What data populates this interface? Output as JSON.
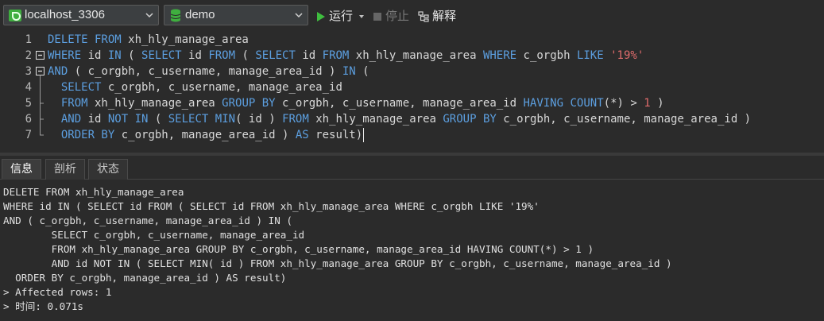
{
  "toolbar": {
    "connection": "localhost_3306",
    "database": "demo",
    "run_label": "运行",
    "stop_label": "停止",
    "explain_label": "解释",
    "colors": {
      "run_green": "#3fbe3f",
      "db_green": "#3fae3f"
    }
  },
  "editor": {
    "lines": [
      {
        "num": "1",
        "fold": "none",
        "tokens": [
          {
            "t": "DELETE FROM",
            "c": "kw"
          },
          {
            "t": " xh_hly_manage_area",
            "c": ""
          }
        ]
      },
      {
        "num": "2",
        "fold": "open",
        "tokens": [
          {
            "t": "WHERE",
            "c": "kw"
          },
          {
            "t": " id ",
            "c": ""
          },
          {
            "t": "IN",
            "c": "kw"
          },
          {
            "t": " ( ",
            "c": ""
          },
          {
            "t": "SELECT",
            "c": "kw"
          },
          {
            "t": " id ",
            "c": ""
          },
          {
            "t": "FROM",
            "c": "kw"
          },
          {
            "t": " ( ",
            "c": ""
          },
          {
            "t": "SELECT",
            "c": "kw"
          },
          {
            "t": " id ",
            "c": ""
          },
          {
            "t": "FROM",
            "c": "kw"
          },
          {
            "t": " xh_hly_manage_area ",
            "c": ""
          },
          {
            "t": "WHERE",
            "c": "kw"
          },
          {
            "t": " c_orgbh ",
            "c": ""
          },
          {
            "t": "LIKE",
            "c": "kw"
          },
          {
            "t": " ",
            "c": ""
          },
          {
            "t": "'19%'",
            "c": "str"
          }
        ]
      },
      {
        "num": "3",
        "fold": "open",
        "tokens": [
          {
            "t": "AND",
            "c": "kw"
          },
          {
            "t": " ( c_orgbh, c_username, manage_area_id ) ",
            "c": ""
          },
          {
            "t": "IN",
            "c": "kw"
          },
          {
            "t": " (",
            "c": ""
          }
        ]
      },
      {
        "num": "4",
        "fold": "line",
        "tokens": [
          {
            "t": "  ",
            "c": ""
          },
          {
            "t": "SELECT",
            "c": "kw"
          },
          {
            "t": " c_orgbh, c_username, manage_area_id",
            "c": ""
          }
        ]
      },
      {
        "num": "5",
        "fold": "dash",
        "tokens": [
          {
            "t": "  ",
            "c": ""
          },
          {
            "t": "FROM",
            "c": "kw"
          },
          {
            "t": " xh_hly_manage_area ",
            "c": ""
          },
          {
            "t": "GROUP BY",
            "c": "kw"
          },
          {
            "t": " c_orgbh, c_username, manage_area_id ",
            "c": ""
          },
          {
            "t": "HAVING",
            "c": "kw"
          },
          {
            "t": " ",
            "c": ""
          },
          {
            "t": "COUNT",
            "c": "kw"
          },
          {
            "t": "(*) > ",
            "c": ""
          },
          {
            "t": "1",
            "c": "num"
          },
          {
            "t": " )",
            "c": ""
          }
        ]
      },
      {
        "num": "6",
        "fold": "dash",
        "tokens": [
          {
            "t": "  ",
            "c": ""
          },
          {
            "t": "AND",
            "c": "kw"
          },
          {
            "t": " id ",
            "c": ""
          },
          {
            "t": "NOT IN",
            "c": "kw"
          },
          {
            "t": " ( ",
            "c": ""
          },
          {
            "t": "SELECT",
            "c": "kw"
          },
          {
            "t": " ",
            "c": ""
          },
          {
            "t": "MIN",
            "c": "kw"
          },
          {
            "t": "( id ) ",
            "c": ""
          },
          {
            "t": "FROM",
            "c": "kw"
          },
          {
            "t": " xh_hly_manage_area ",
            "c": ""
          },
          {
            "t": "GROUP BY",
            "c": "kw"
          },
          {
            "t": " c_orgbh, c_username, manage_area_id )",
            "c": ""
          }
        ]
      },
      {
        "num": "7",
        "fold": "end",
        "tokens": [
          {
            "t": "  ",
            "c": ""
          },
          {
            "t": "ORDER BY",
            "c": "kw"
          },
          {
            "t": " c_orgbh, manage_area_id ) ",
            "c": ""
          },
          {
            "t": "AS",
            "c": "kw"
          },
          {
            "t": " result)",
            "c": ""
          }
        ]
      }
    ]
  },
  "tabs": [
    {
      "label": "信息",
      "active": true
    },
    {
      "label": "剖析",
      "active": false
    },
    {
      "label": "状态",
      "active": false
    }
  ],
  "output": {
    "lines": [
      "DELETE FROM xh_hly_manage_area",
      "WHERE id IN ( SELECT id FROM ( SELECT id FROM xh_hly_manage_area WHERE c_orgbh LIKE '19%'",
      "AND ( c_orgbh, c_username, manage_area_id ) IN (",
      "        SELECT c_orgbh, c_username, manage_area_id",
      "        FROM xh_hly_manage_area GROUP BY c_orgbh, c_username, manage_area_id HAVING COUNT(*) > 1 )",
      "        AND id NOT IN ( SELECT MIN( id ) FROM xh_hly_manage_area GROUP BY c_orgbh, c_username, manage_area_id )",
      "  ORDER BY c_orgbh, manage_area_id ) AS result)",
      "> Affected rows: 1",
      "> 时间: 0.071s"
    ]
  }
}
